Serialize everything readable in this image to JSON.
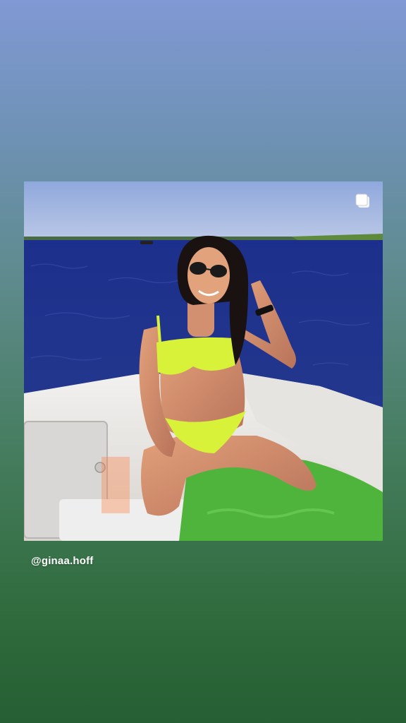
{
  "story": {
    "background_top": "#8199d4",
    "background_bottom": "#255f33"
  },
  "post": {
    "image_description_icon": "multiple-photos-icon",
    "mention": "@ginaa.hoff"
  }
}
